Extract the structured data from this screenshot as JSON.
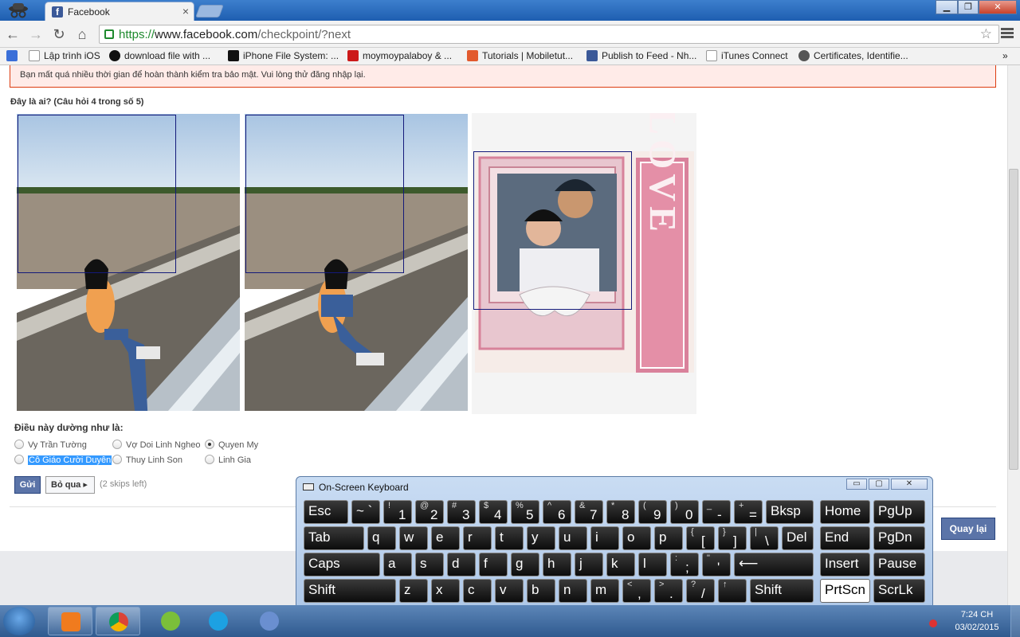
{
  "browser": {
    "tab_title": "Facebook",
    "tab_close": "×",
    "url_scheme": "https://",
    "url_domain": "www.facebook.com",
    "url_path": "/checkpoint/?next",
    "bookmarks": [
      {
        "label": "Lập trình iOS",
        "icon": "page-icon"
      },
      {
        "label": "download file with ...",
        "icon": "s-icon"
      },
      {
        "label": "iPhone File System: ...",
        "icon": "ios-icon"
      },
      {
        "label": "moymoypalaboy & ...",
        "icon": "youtube-icon"
      },
      {
        "label": "Tutorials | Mobiletut...",
        "icon": "plus-icon"
      },
      {
        "label": "Publish to Feed - Nh...",
        "icon": "facebook-icon"
      },
      {
        "label": "iTunes Connect",
        "icon": "page-icon"
      },
      {
        "label": "Certificates, Identifie...",
        "icon": "apple-icon"
      }
    ]
  },
  "checkpoint": {
    "notice": "Bạn mất quá nhiều thời gian để hoàn thành kiểm tra bảo mật. Vui lòng thử đăng nhập lại.",
    "question": "Đây là ai? (Câu hỏi 4 trong số 5)",
    "suggest_title": "Điều này dường như là:",
    "options": [
      {
        "label": "Vy Trần Tường",
        "checked": false
      },
      {
        "label": "Vợ Doi Linh Ngheo",
        "checked": false
      },
      {
        "label": "Quyen My",
        "checked": true
      },
      {
        "label": "Cô Giáo Cười Duyên",
        "checked": false,
        "selected_text": true
      },
      {
        "label": "Thuy Linh Son",
        "checked": false
      },
      {
        "label": "Linh Gia",
        "checked": false
      }
    ],
    "submit_label": "Gửi",
    "skip_label": "Bỏ qua ▸",
    "skips_left": "(2 skips left)",
    "back_label": "Quay lại",
    "love_text": "LOVE"
  },
  "osk": {
    "title": "On-Screen Keyboard",
    "min": "▭",
    "max": "▢",
    "close": "✕"
  },
  "taskbar": {
    "time": "7:24 CH",
    "date": "03/02/2015"
  }
}
